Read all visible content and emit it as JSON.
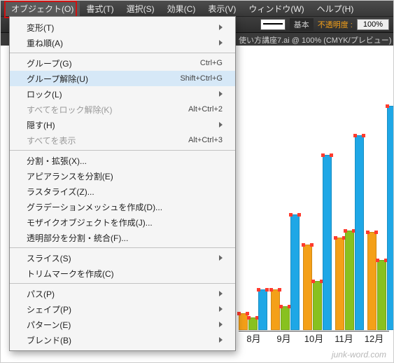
{
  "menubar": {
    "items": [
      "オブジェクト(O)",
      "書式(T)",
      "選択(S)",
      "効果(C)",
      "表示(V)",
      "ウィンドウ(W)",
      "ヘルプ(H)"
    ]
  },
  "controlbar": {
    "preset": "基本",
    "opacity_label": "不透明度 :",
    "opacity_value": "100%"
  },
  "doctab": {
    "title": "使い方講座7.ai @ 100% (CMYK/プレビュー)"
  },
  "menu": {
    "items": [
      {
        "label": "変形(T)"
      },
      {
        "label": "重ね順(A)"
      },
      {
        "label": "グループ(G)",
        "shortcut": "Ctrl+G"
      },
      {
        "label": "グループ解除(U)",
        "shortcut": "Shift+Ctrl+G",
        "hover": true
      },
      {
        "label": "ロック(L)"
      },
      {
        "label": "すべてをロック解除(K)",
        "shortcut": "Alt+Ctrl+2",
        "disabled": true
      },
      {
        "label": "隠す(H)"
      },
      {
        "label": "すべてを表示",
        "shortcut": "Alt+Ctrl+3",
        "disabled": true
      },
      {
        "label": "分割・拡張(X)..."
      },
      {
        "label": "アピアランスを分割(E)"
      },
      {
        "label": "ラスタライズ(Z)..."
      },
      {
        "label": "グラデーションメッシュを作成(D)..."
      },
      {
        "label": "モザイクオブジェクトを作成(J)..."
      },
      {
        "label": "透明部分を分割・統合(F)..."
      },
      {
        "label": "スライス(S)"
      },
      {
        "label": "トリムマークを作成(C)"
      },
      {
        "label": "パス(P)"
      },
      {
        "label": "シェイプ(P)"
      },
      {
        "label": "パターン(E)"
      },
      {
        "label": "ブレンド(B)"
      }
    ]
  },
  "chart_data": {
    "type": "bar",
    "note": "Visible portion of a multi-series bar chart (selected). Values are estimated relative heights, not actual data values (no y-axis visible).",
    "categories": [
      "8月",
      "9月",
      "10月",
      "11月",
      "12月"
    ],
    "series": [
      {
        "name": "orange",
        "color": "#f4a018",
        "values": [
          24,
          58,
          122,
          132,
          140
        ]
      },
      {
        "name": "green",
        "color": "#88c11f",
        "values": [
          18,
          34,
          70,
          142,
          100
        ]
      },
      {
        "name": "blue",
        "color": "#1ea7e6",
        "values": [
          58,
          165,
          250,
          278,
          320
        ]
      }
    ]
  },
  "watermark": "junk-word.com"
}
